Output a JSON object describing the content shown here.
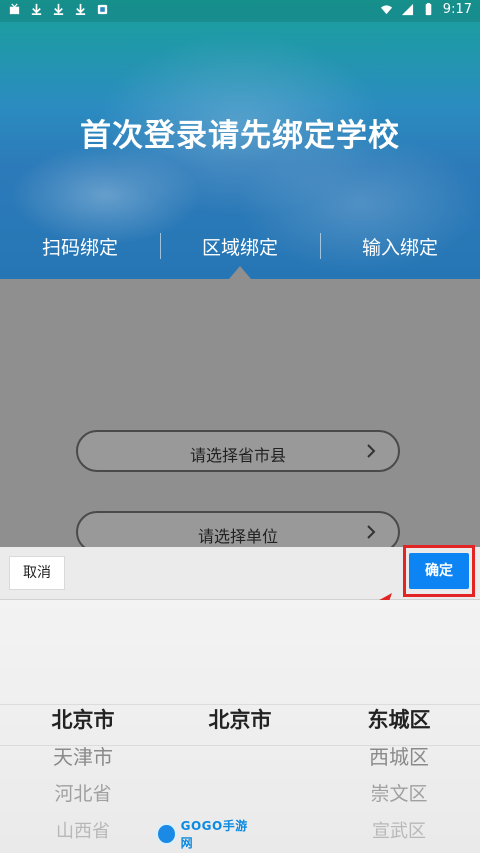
{
  "status": {
    "time": "9:17",
    "icons": [
      "notification-icon",
      "download-icon",
      "download-icon",
      "download-icon",
      "notification-icon",
      "wifi-icon",
      "signal-icon",
      "battery-icon"
    ]
  },
  "hero": {
    "title": "首次登录请先绑定学校"
  },
  "tabs": [
    {
      "label": "扫码绑定"
    },
    {
      "label": "区域绑定"
    },
    {
      "label": "输入绑定"
    }
  ],
  "form": {
    "province_placeholder": "请选择省市县",
    "unit_placeholder": "请选择单位"
  },
  "sheet": {
    "cancel_label": "取消",
    "confirm_label": "确定"
  },
  "picker": {
    "province": [
      "北京市",
      "天津市",
      "河北省",
      "山西省"
    ],
    "city": [
      "北京市"
    ],
    "district": [
      "东城区",
      "西城区",
      "崇文区",
      "宣武区"
    ]
  },
  "watermark": {
    "text": "GOGO手游网"
  },
  "colors": {
    "accent": "#0d84f4",
    "highlight": "#e32424",
    "hero_blue": "#2676b5"
  }
}
